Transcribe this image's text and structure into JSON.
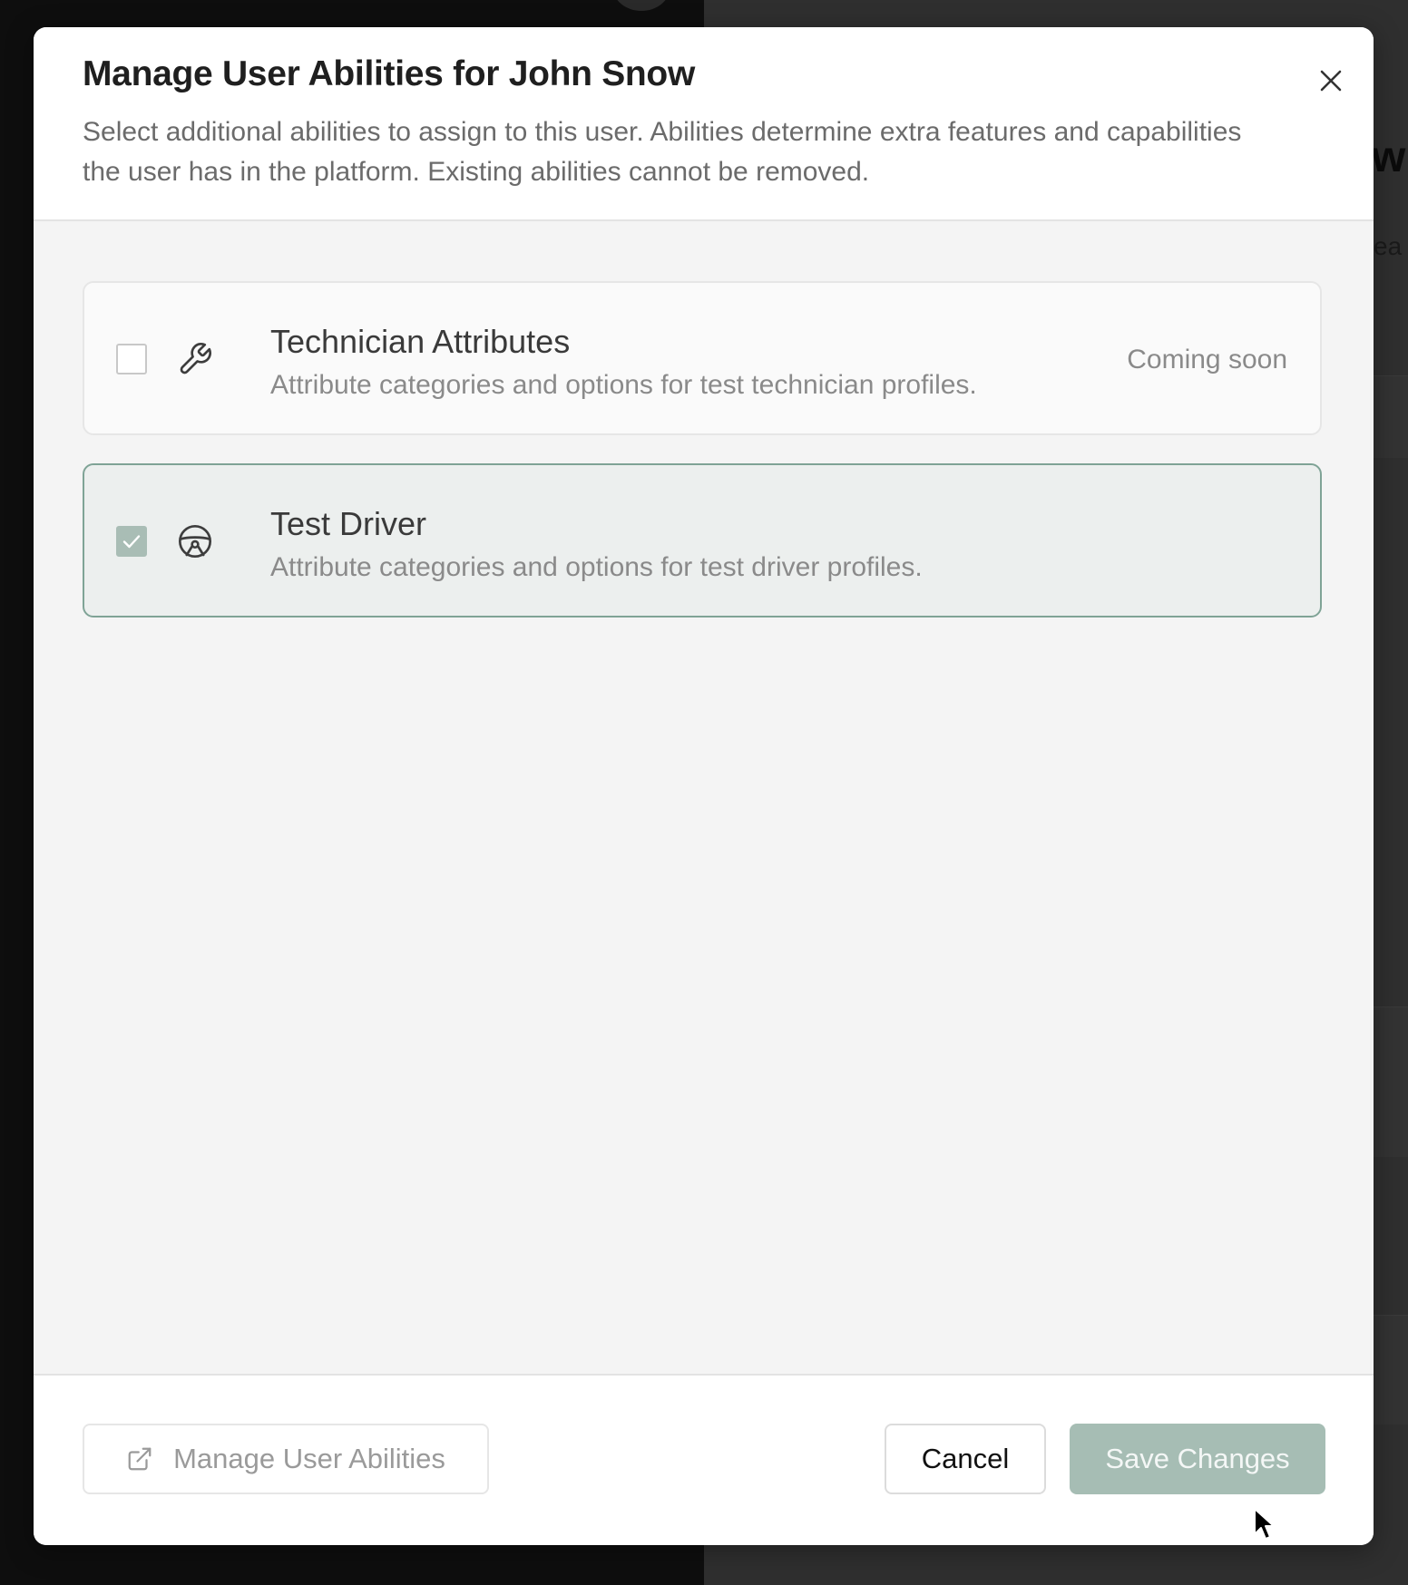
{
  "backdrop": {
    "heading_fragment": "w",
    "subtext_fragment": "ea"
  },
  "dialog": {
    "title": "Manage User Abilities for John Snow",
    "description": "Select additional abilities to assign to this user. Abilities determine extra features and capabilities the user has in the platform. Existing abilities cannot be removed.",
    "close_icon": "close-icon"
  },
  "abilities": [
    {
      "title": "Technician Attributes",
      "description": "Attribute categories and options for test technician profiles.",
      "status": "Coming soon",
      "checked": false,
      "icon": "wrench-icon"
    },
    {
      "title": "Test Driver",
      "description": "Attribute categories and options for test driver profiles.",
      "checked": true,
      "icon": "steering-wheel-icon"
    }
  ],
  "footer": {
    "manage_label": "Manage User Abilities",
    "manage_icon": "external-link-icon",
    "cancel_label": "Cancel",
    "save_label": "Save Changes"
  },
  "colors": {
    "accent": "#7fa396",
    "save_button": "#a6bdb4",
    "selected_card_bg": "#ecefee"
  }
}
